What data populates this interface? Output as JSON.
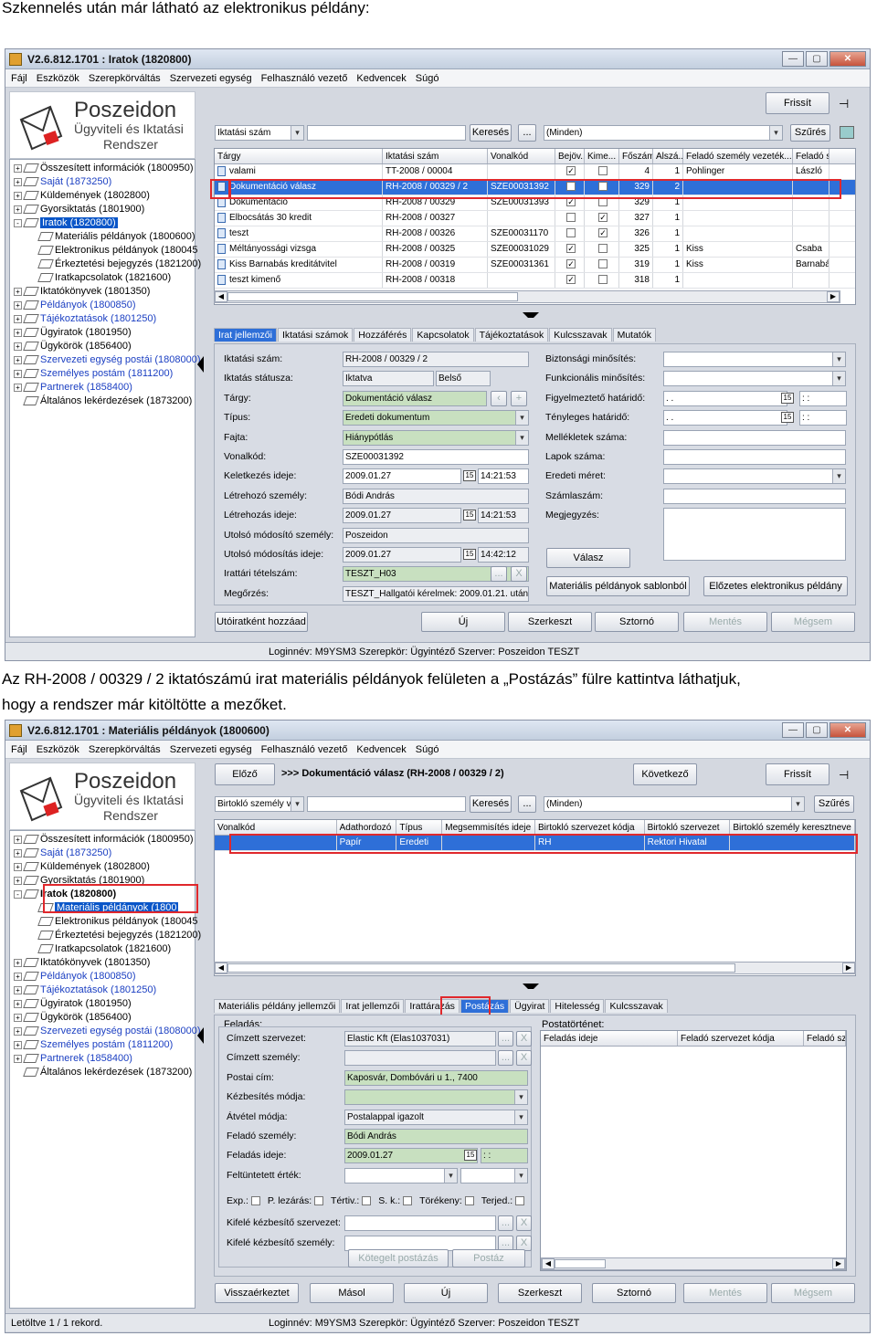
{
  "doc": {
    "heading1": "Szkennelés után már látható az elektronikus példány:",
    "paragraph2_line1": "Az  RH-2008  /  00329  /  2  iktatószámú  irat  materiális  példányok  felületen  a  „Postázás”  fülre  kattintva  láthatjuk,",
    "paragraph2_line2": "hogy a rendszer már kitöltötte a mezőket."
  },
  "menu": [
    "Fájl",
    "Eszközök",
    "Szerepkörváltás",
    "Szervezeti egység",
    "Felhasználó vezető",
    "Kedvencek",
    "Súgó"
  ],
  "logo": {
    "name": "Poszeidon",
    "line2": "Ügyviteli és Iktatási",
    "line3": "Rendszer"
  },
  "common": {
    "refresh": "Frissít",
    "search": "Keresés",
    "dots": "...",
    "filter_value": "(Minden)",
    "filter_btn": "Szűrés",
    "status_text": "Loginnév: M9YSM3   Szerepkör: Ügyintéző   Szerver: Poszeidon TESZT"
  },
  "window1": {
    "title": "V2.6.812.1701 : Iratok (1820800)",
    "search_field": "Iktatási szám",
    "tree": [
      {
        "label": "Összesített információk (1800950)",
        "exp": "+",
        "lvl": 0,
        "c": ""
      },
      {
        "label": "Saját (1873250)",
        "exp": "+",
        "lvl": 0,
        "c": "blue"
      },
      {
        "label": "Küldemények (1802800)",
        "exp": "+",
        "lvl": 0,
        "c": ""
      },
      {
        "label": "Gyorsiktatás (1801900)",
        "exp": "+",
        "lvl": 0,
        "c": ""
      },
      {
        "label": "Iratok (1820800)",
        "exp": "-",
        "lvl": 0,
        "c": "sel"
      },
      {
        "label": "Materiális példányok (1800600)",
        "exp": "",
        "lvl": 1,
        "c": ""
      },
      {
        "label": "Elektronikus példányok (180045",
        "exp": "",
        "lvl": 1,
        "c": ""
      },
      {
        "label": "Érkeztetési bejegyzés (1821200)",
        "exp": "",
        "lvl": 1,
        "c": ""
      },
      {
        "label": "Iratkapcsolatok (1821600)",
        "exp": "",
        "lvl": 1,
        "c": ""
      },
      {
        "label": "Iktatókönyvek (1801350)",
        "exp": "+",
        "lvl": 0,
        "c": ""
      },
      {
        "label": "Példányok (1800850)",
        "exp": "+",
        "lvl": 0,
        "c": "blue"
      },
      {
        "label": "Tájékoztatások (1801250)",
        "exp": "+",
        "lvl": 0,
        "c": "blue"
      },
      {
        "label": "Ügyiratok (1801950)",
        "exp": "+",
        "lvl": 0,
        "c": ""
      },
      {
        "label": "Ügykörök (1856400)",
        "exp": "+",
        "lvl": 0,
        "c": ""
      },
      {
        "label": "Szervezeti egység postái (1808000)",
        "exp": "+",
        "lvl": 0,
        "c": "blue"
      },
      {
        "label": "Személyes postám (1811200)",
        "exp": "+",
        "lvl": 0,
        "c": "blue"
      },
      {
        "label": "Partnerek (1858400)",
        "exp": "+",
        "lvl": 0,
        "c": "blue"
      },
      {
        "label": "Általános lekérdezések (1873200)",
        "exp": "",
        "lvl": 0,
        "c": ""
      }
    ],
    "columns": [
      "Tárgy",
      "Iktatási szám",
      "Vonalkód",
      "Bejöv...",
      "Kime...",
      "Főszám",
      "Alszá...",
      "Feladó személy vezeték...",
      "Feladó sz"
    ],
    "rows": [
      [
        "valami",
        "TT-2008 / 00004",
        "",
        "✓",
        "",
        "4",
        "1",
        "Pohlinger",
        "László"
      ],
      [
        "Dokumentáció válasz",
        "RH-2008 / 00329 / 2",
        "SZE00031392",
        "✓",
        "",
        "329",
        "2",
        "",
        ""
      ],
      [
        "Dokumentáció",
        "RH-2008 / 00329",
        "SZE00031393",
        "✓",
        "",
        "329",
        "1",
        "",
        ""
      ],
      [
        "Elbocsátás 30 kredit",
        "RH-2008 / 00327",
        "",
        "",
        "✓",
        "327",
        "1",
        "",
        ""
      ],
      [
        "teszt",
        "RH-2008 / 00326",
        "SZE00031170",
        "",
        "✓",
        "326",
        "1",
        "",
        ""
      ],
      [
        "Méltányossági vizsga",
        "RH-2008 / 00325",
        "SZE00031029",
        "✓",
        "",
        "325",
        "1",
        "Kiss",
        "Csaba"
      ],
      [
        "Kiss Barnabás kreditátvitel",
        "RH-2008 / 00319",
        "SZE00031361",
        "✓",
        "",
        "319",
        "1",
        "Kiss",
        "Barnabá"
      ],
      [
        "teszt kimenő",
        "RH-2008 / 00318",
        "",
        "✓",
        "",
        "318",
        "1",
        "",
        ""
      ]
    ],
    "tabs": [
      "Irat jellemzői",
      "Iktatási számok",
      "Hozzáférés",
      "Kapcsolatok",
      "Tájékoztatások",
      "Kulcsszavak",
      "Mutatók"
    ],
    "form_left": [
      {
        "label": "Iktatási szám:",
        "value": "RH-2008 / 00329 / 2",
        "style": "d"
      },
      {
        "label": "Iktatás státusza:",
        "value": "Iktatva",
        "value2": "Belső",
        "style": "d"
      },
      {
        "label": "Tárgy:",
        "value": "Dokumentáció válasz",
        "style": "g"
      },
      {
        "label": "Típus:",
        "value": "Eredeti dokumentum",
        "style": "g"
      },
      {
        "label": "Fajta:",
        "value": "Hiánypótlás",
        "style": "g"
      },
      {
        "label": "Vonalkód:",
        "value": "SZE00031392",
        "style": ""
      },
      {
        "label": "Keletkezés ideje:",
        "value": "2009.01.27",
        "time": "14:21:53",
        "style": ""
      },
      {
        "label": "Létrehozó személy:",
        "value": "Bódi András",
        "style": "d"
      },
      {
        "label": "Létrehozás ideje:",
        "value": "2009.01.27",
        "time": "14:21:53",
        "style": "d"
      },
      {
        "label": "Utolsó módosító személy:",
        "value": "Poszeidon",
        "style": "d"
      },
      {
        "label": "Utolsó módosítás ideje:",
        "value": "2009.01.27",
        "time": "14:42:12",
        "style": "d"
      },
      {
        "label": "Irattári tételszám:",
        "value": "TESZT_H03",
        "style": "g"
      },
      {
        "label": "Megőrzés:",
        "value": "TESZT_Hallgatói kérelmek: 2009.01.21. után",
        "style": "d"
      }
    ],
    "form_right": [
      {
        "label": "Biztonsági minősítés:",
        "value": ""
      },
      {
        "label": "Funkcionális minősítés:",
        "value": ""
      },
      {
        "label": "Figyelmeztető határidő:",
        "value": " .  .",
        "time": " :  :"
      },
      {
        "label": "Tényleges határidő:",
        "value": " .  .",
        "time": " :  :"
      },
      {
        "label": "Mellékletek száma:",
        "value": ""
      },
      {
        "label": "Lapok száma:",
        "value": ""
      },
      {
        "label": "Eredeti méret:",
        "value": ""
      },
      {
        "label": "Számlaszám:",
        "value": ""
      },
      {
        "label": "Megjegyzés:",
        "value": ""
      }
    ],
    "reply_btn": "Válasz",
    "template_btn": "Materiális példányok sablonból",
    "prev_electronic_btn": "Előzetes elektronikus példány",
    "bottom_buttons": [
      "Utóiratként hozzáad",
      "Új",
      "Szerkeszt",
      "Sztornó",
      "Mentés",
      "Mégsem"
    ]
  },
  "window2": {
    "title": "V2.6.812.1701 : Materiális példányok (1800600)",
    "prev": "Előző",
    "next": "Következő",
    "header_text": ">>> Dokumentáció válasz (RH-2008 / 00329 / 2)",
    "search_field": "Birtokló személy v",
    "tree": [
      {
        "label": "Összesített információk (1800950)",
        "exp": "+",
        "lvl": 0,
        "c": ""
      },
      {
        "label": "Saját (1873250)",
        "exp": "+",
        "lvl": 0,
        "c": "blue"
      },
      {
        "label": "Küldemények (1802800)",
        "exp": "+",
        "lvl": 0,
        "c": ""
      },
      {
        "label": "Gyorsiktatás (1801900)",
        "exp": "+",
        "lvl": 0,
        "c": ""
      },
      {
        "label": "Iratok (1820800)",
        "exp": "-",
        "lvl": 0,
        "c": "bold"
      },
      {
        "label": "Materiális példányok (1800",
        "exp": "",
        "lvl": 1,
        "c": "sel"
      },
      {
        "label": "Elektronikus példányok (180045",
        "exp": "",
        "lvl": 1,
        "c": ""
      },
      {
        "label": "Érkeztetési bejegyzés (1821200)",
        "exp": "",
        "lvl": 1,
        "c": ""
      },
      {
        "label": "Iratkapcsolatok (1821600)",
        "exp": "",
        "lvl": 1,
        "c": ""
      },
      {
        "label": "Iktatókönyvek (1801350)",
        "exp": "+",
        "lvl": 0,
        "c": ""
      },
      {
        "label": "Példányok (1800850)",
        "exp": "+",
        "lvl": 0,
        "c": "blue"
      },
      {
        "label": "Tájékoztatások (1801250)",
        "exp": "+",
        "lvl": 0,
        "c": "blue"
      },
      {
        "label": "Ügyiratok (1801950)",
        "exp": "+",
        "lvl": 0,
        "c": ""
      },
      {
        "label": "Ügykörök (1856400)",
        "exp": "+",
        "lvl": 0,
        "c": ""
      },
      {
        "label": "Szervezeti egység postái (1808000)",
        "exp": "+",
        "lvl": 0,
        "c": "blue"
      },
      {
        "label": "Személyes postám (1811200)",
        "exp": "+",
        "lvl": 0,
        "c": "blue"
      },
      {
        "label": "Partnerek (1858400)",
        "exp": "+",
        "lvl": 0,
        "c": "blue"
      },
      {
        "label": "Általános lekérdezések (1873200)",
        "exp": "",
        "lvl": 0,
        "c": ""
      }
    ],
    "columns": [
      "Vonalkód",
      "Adathordozó",
      "Típus",
      "Megsemmisítés ideje",
      "Birtokló szervezet kódja",
      "Birtokló szervezet",
      "Birtokló személy keresztneve"
    ],
    "row": [
      "",
      "Papír",
      "Eredeti",
      "",
      "RH",
      "Rektori Hivatal",
      ""
    ],
    "tabs": [
      "Materiális példány jellemzői",
      "Irat jellemzői",
      "Irattárazás",
      "Postázás",
      "Ügyirat",
      "Hitelesség",
      "Kulcsszavak"
    ],
    "group_send": "Feladás:",
    "group_history": "Postatörténet:",
    "form": [
      {
        "label": "Címzett szervezet:",
        "value": "Elastic Kft (Elas1037031)",
        "style": "d"
      },
      {
        "label": "Címzett személy:",
        "value": "",
        "style": "d"
      },
      {
        "label": "Postai cím:",
        "value": "Kaposvár, Dombóvári u 1., 7400",
        "style": "g"
      },
      {
        "label": "Kézbesítés módja:",
        "value": "",
        "style": "g"
      },
      {
        "label": "Átvétel módja:",
        "value": "Postalappal igazolt",
        "style": "d"
      },
      {
        "label": "Feladó személy:",
        "value": "Bódi András",
        "style": "g"
      },
      {
        "label": "Feladás ideje:",
        "value": "2009.01.27",
        "time": " :  :",
        "style": "g"
      },
      {
        "label": "Feltüntetett érték:",
        "value": "",
        "style": ""
      }
    ],
    "checks": [
      "Exp.:",
      "P. lezárás:",
      "Tértiv.:",
      "S. k.:",
      "Törékeny:",
      "Terjed.:"
    ],
    "form2": [
      {
        "label": "Kifelé kézbesítő szervezet:",
        "value": ""
      },
      {
        "label": "Kifelé kézbesítő személy:",
        "value": ""
      }
    ],
    "batch_btn": "Kötegelt postázás",
    "post_btn": "Postáz",
    "hist_columns": [
      "Feladás ideje",
      "Feladó szervezet kódja",
      "Feladó sz"
    ],
    "bottom_buttons": [
      "Visszaérkeztet",
      "Másol",
      "Új",
      "Szerkeszt",
      "Sztornó",
      "Mentés",
      "Mégsem"
    ],
    "status_left": "Letöltve 1 / 1 rekord."
  },
  "colors": {
    "accent": "#2e6fd8",
    "highlight_red": "#e0282c",
    "required_green": "#c8e0c0"
  }
}
